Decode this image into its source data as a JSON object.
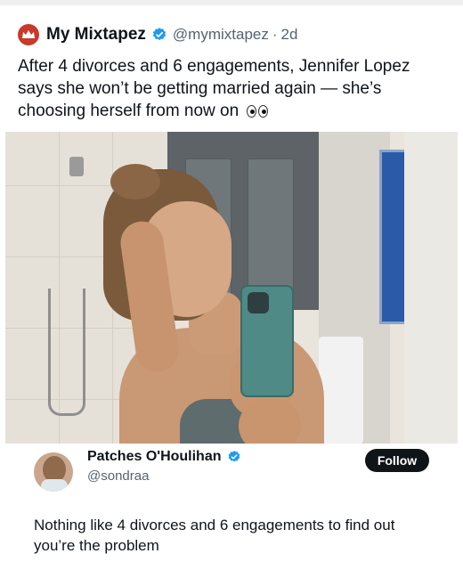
{
  "tweet": {
    "display_name": "My Mixtapez",
    "handle": "@mymixtapez",
    "separator": "·",
    "time": "2d",
    "text": "After 4 divorces and 6 engagements, Jennifer Lopez says she won’t be getting married again — she’s choosing herself from now on",
    "emoji": "eyes-emoji",
    "avatar_icon": "crown-logo-icon",
    "verified_icon": "verified-badge-icon"
  },
  "reply": {
    "display_name": "Patches O'Houlihan",
    "handle": "@sondraa",
    "follow_label": "Follow",
    "text": "Nothing like 4 divorces and 6 engagements to find out you’re the problem",
    "verified_icon": "verified-badge-icon"
  },
  "colors": {
    "brand_red": "#c83a2a",
    "verified_blue": "#1d9bf0",
    "text_primary": "#0f1419",
    "text_secondary": "#536471",
    "follow_bg": "#0f1419"
  }
}
